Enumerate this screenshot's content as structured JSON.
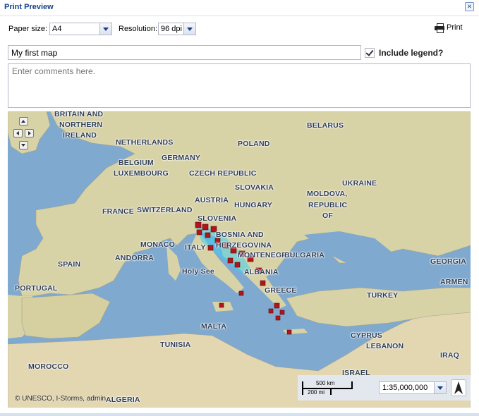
{
  "window": {
    "title": "Print Preview"
  },
  "toolbar": {
    "paper_size_label": "Paper size:",
    "paper_size_value": "A4",
    "resolution_label": "Resolution:",
    "resolution_value": "96 dpi",
    "print_label": "Print"
  },
  "form": {
    "title_value": "My first map",
    "comments_placeholder": "Enter comments here.",
    "include_legend_label": "Include legend?",
    "include_legend_checked": true
  },
  "map": {
    "labels": [
      {
        "text": "BRITAIN AND"
      },
      {
        "text": "NORTHERN"
      },
      {
        "text": "IRELAND"
      },
      {
        "text": "NETHERLANDS"
      },
      {
        "text": "BELARUS"
      },
      {
        "text": "POLAND"
      },
      {
        "text": "GERMANY"
      },
      {
        "text": "BELGIUM"
      },
      {
        "text": "LUXEMBOURG"
      },
      {
        "text": "CZECH REPUBLIC"
      },
      {
        "text": "UKRAINE"
      },
      {
        "text": "SLOVAKIA"
      },
      {
        "text": "MOLDOVA,"
      },
      {
        "text": "REPUBLIC"
      },
      {
        "text": "OF"
      },
      {
        "text": "AUSTRIA"
      },
      {
        "text": "HUNGARY"
      },
      {
        "text": "FRANCE"
      },
      {
        "text": "SWITZERLAND"
      },
      {
        "text": "SLOVENIA"
      },
      {
        "text": "BOSNIA AND"
      },
      {
        "text": "HERZEGOVINA"
      },
      {
        "text": "MONACO"
      },
      {
        "text": "ITALY"
      },
      {
        "text": "MONTENEGRO"
      },
      {
        "text": "BULGARIA"
      },
      {
        "text": "ANDORRA"
      },
      {
        "text": "SPAIN"
      },
      {
        "text": "Holy See"
      },
      {
        "text": "ALBANIA"
      },
      {
        "text": "GEORGIA"
      },
      {
        "text": "ARMEN"
      },
      {
        "text": "PORTUGAL"
      },
      {
        "text": "GREECE"
      },
      {
        "text": "TURKEY"
      },
      {
        "text": "MALTA"
      },
      {
        "text": "CYPRUS"
      },
      {
        "text": "TUNISIA"
      },
      {
        "text": "LEBANON"
      },
      {
        "text": "IRAQ"
      },
      {
        "text": "MOROCCO"
      },
      {
        "text": "ISRAEL"
      },
      {
        "text": "ALGERIA"
      }
    ],
    "attribution": "© UNESCO, I-Storms, admin",
    "scale_top": "500 km",
    "scale_bottom": "200 mi",
    "scale_value": "1:35,000,000",
    "colors": {
      "sea": "#7fa9cf",
      "land": "#d9d3a6",
      "marker": "#b3141b",
      "highlight": "#3fd0f0"
    }
  }
}
